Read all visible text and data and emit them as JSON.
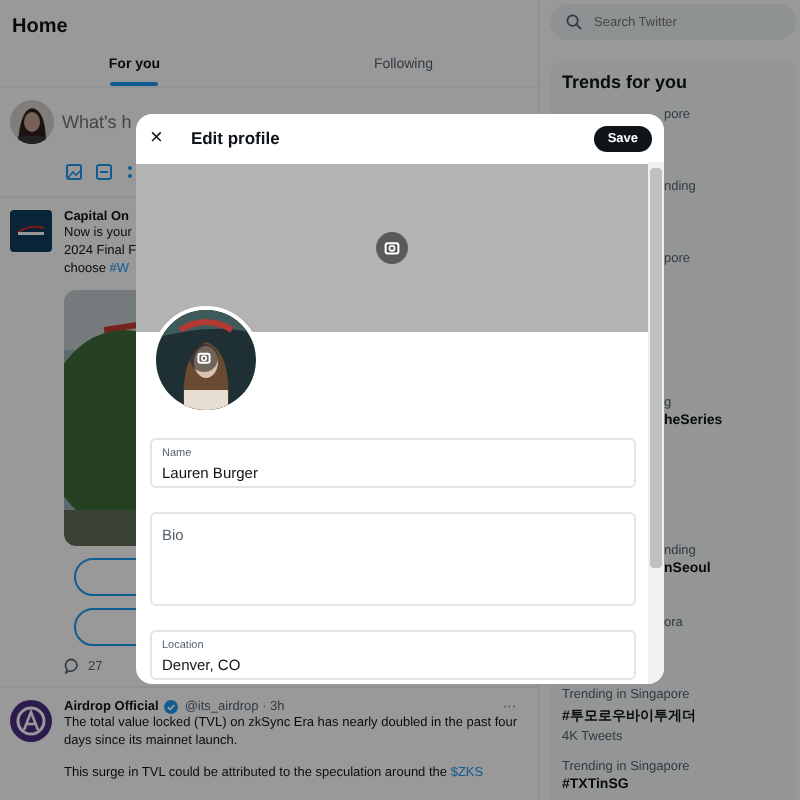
{
  "header": {
    "title": "Home"
  },
  "tabs": [
    {
      "label": "For you",
      "selected": true
    },
    {
      "label": "Following",
      "selected": false
    }
  ],
  "composer": {
    "placeholder": "What's h"
  },
  "posts": [
    {
      "kind": "ad",
      "author": "Capital On",
      "lines": [
        "Now is your",
        "2024 Final F"
      ],
      "last_line": {
        "text": "choose",
        "hashtag": "#W"
      },
      "comments": "27"
    },
    {
      "kind": "tweet",
      "author": "Airdrop Official",
      "verified": true,
      "handle": "@its_airdrop · 3h",
      "menu": "···",
      "paragraphs": [
        {
          "text": "The total value locked (TVL) on zkSync Era has nearly doubled in the past four days since its mainnet launch."
        },
        {
          "text": "This surge in TVL could be attributed to the speculation around the",
          "cashtag": "$ZKS"
        }
      ]
    }
  ],
  "search": {
    "placeholder": "Search Twitter"
  },
  "trends": {
    "title": "Trends for you",
    "items": [
      {
        "kind": "clipped",
        "context": "pore"
      },
      {
        "kind": "clipped",
        "context": "nding"
      },
      {
        "kind": "clipped",
        "context": "pore"
      },
      {
        "kind": "clipped",
        "context": "g",
        "name": "heSeries"
      },
      {
        "kind": "clipped",
        "context": "nding",
        "name": "nSeoul"
      },
      {
        "kind": "clipped",
        "context": "ora"
      },
      {
        "kind": "full",
        "context": "Trending in Singapore",
        "name": "#투모로우바이투게더",
        "count": "4K Tweets"
      },
      {
        "kind": "full",
        "context": "Trending in Singapore",
        "name": "#TXTinSG"
      }
    ]
  },
  "modal": {
    "close": "×",
    "title": "Edit profile",
    "save": "Save",
    "fields": [
      {
        "label": "Name",
        "value": "Lauren Burger"
      },
      {
        "label": "Bio"
      },
      {
        "label": "Location",
        "value": "Denver, CO"
      }
    ]
  }
}
